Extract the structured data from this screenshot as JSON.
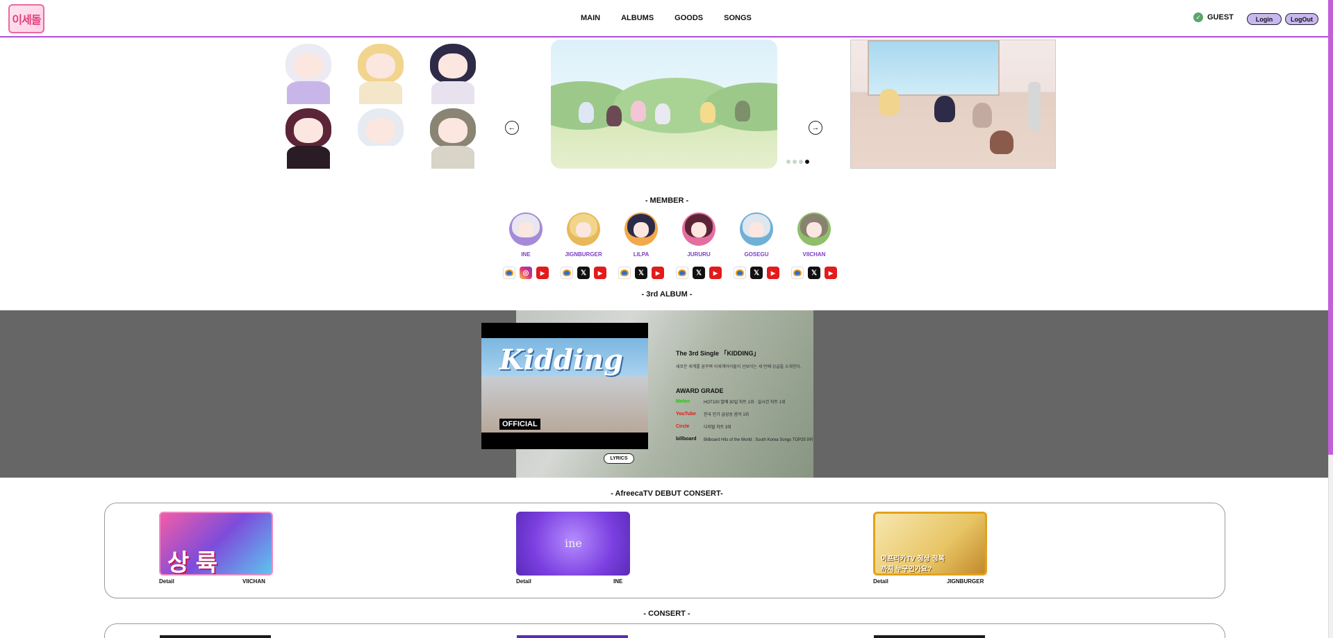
{
  "header": {
    "logo_alt": "이세계아이돌",
    "nav": [
      {
        "label": "MAIN"
      },
      {
        "label": "ALBUMS"
      },
      {
        "label": "GOODS"
      },
      {
        "label": "SONGS"
      }
    ],
    "user_name": "GUEST",
    "login_label": "Login",
    "logout_label": "LogOut"
  },
  "carousel": {
    "active_dot": 4,
    "dot_count": 4
  },
  "members_section": {
    "title": "- MEMBER -",
    "members": [
      {
        "name": "INE",
        "hair": "#e8e6ee",
        "accent": "#a58ad8",
        "socials": [
          "afreeca",
          "instagram",
          "youtube"
        ]
      },
      {
        "name": "JIGNBURGER",
        "hair": "#f0d58a",
        "accent": "#e9b85a",
        "socials": [
          "afreeca",
          "x",
          "youtube"
        ]
      },
      {
        "name": "LILPA",
        "hair": "#2b2a4a",
        "accent": "#f3a84b",
        "socials": [
          "afreeca",
          "x",
          "youtube"
        ]
      },
      {
        "name": "JURURU",
        "hair": "#5a2436",
        "accent": "#e56ea1",
        "socials": [
          "afreeca",
          "x",
          "youtube"
        ]
      },
      {
        "name": "GOSEGU",
        "hair": "#dfe6ee",
        "accent": "#6fb0d6",
        "socials": [
          "afreeca",
          "x",
          "youtube"
        ]
      },
      {
        "name": "VIICHAN",
        "hair": "#8a8270",
        "accent": "#8fbf6a",
        "socials": [
          "afreeca",
          "x",
          "youtube"
        ]
      }
    ]
  },
  "album_section": {
    "title": "- 3rd ALBUM -",
    "video_title": "Kidding",
    "video_badge": "OFFICIAL",
    "album_title": "The 3rd Single 「KIDDING」",
    "album_desc": "새로운 세계를 꿈꾸며 이세계아이돌이 선보이는 세 번째 싱글을 소개한다.",
    "award_title": "AWARD GRADE",
    "awards": [
      {
        "logo": "Melon",
        "logo_color": "#1ec800",
        "text": "HOT100 발매 30일 차트 1위 · 실시간 차트 1위"
      },
      {
        "logo": "YouTube",
        "logo_color": "#e21b1b",
        "text": "한국 인기 급상승 음악 1위"
      },
      {
        "logo": "Circle",
        "logo_color": "#e21b1b",
        "text": "디지털 차트 3위"
      },
      {
        "logo": "billboard",
        "logo_color": "#111111",
        "text": "Billboard Hits of the World : South Korea Songs TOP25 9위"
      }
    ],
    "lyrics_label": "LYRICS"
  },
  "debut_section": {
    "title": "- AfreecaTV DEBUT CONSERT-",
    "cards": [
      {
        "detail": "Detail",
        "member": "VIICHAN",
        "thumb_text": "상 륙"
      },
      {
        "detail": "Detail",
        "member": "INE",
        "thumb_text": "ine"
      },
      {
        "detail": "Detail",
        "member": "JIGNBURGER",
        "thumb_text": "이프리카TV 정상 정복까지 누구인가요?"
      }
    ]
  },
  "concert_section": {
    "title": "- CONSERT -"
  },
  "colors": {
    "accent": "#b24bd6",
    "member_name": "#7a3fc0",
    "album_band": "#666666",
    "button_fill": "#c9b8f0"
  }
}
